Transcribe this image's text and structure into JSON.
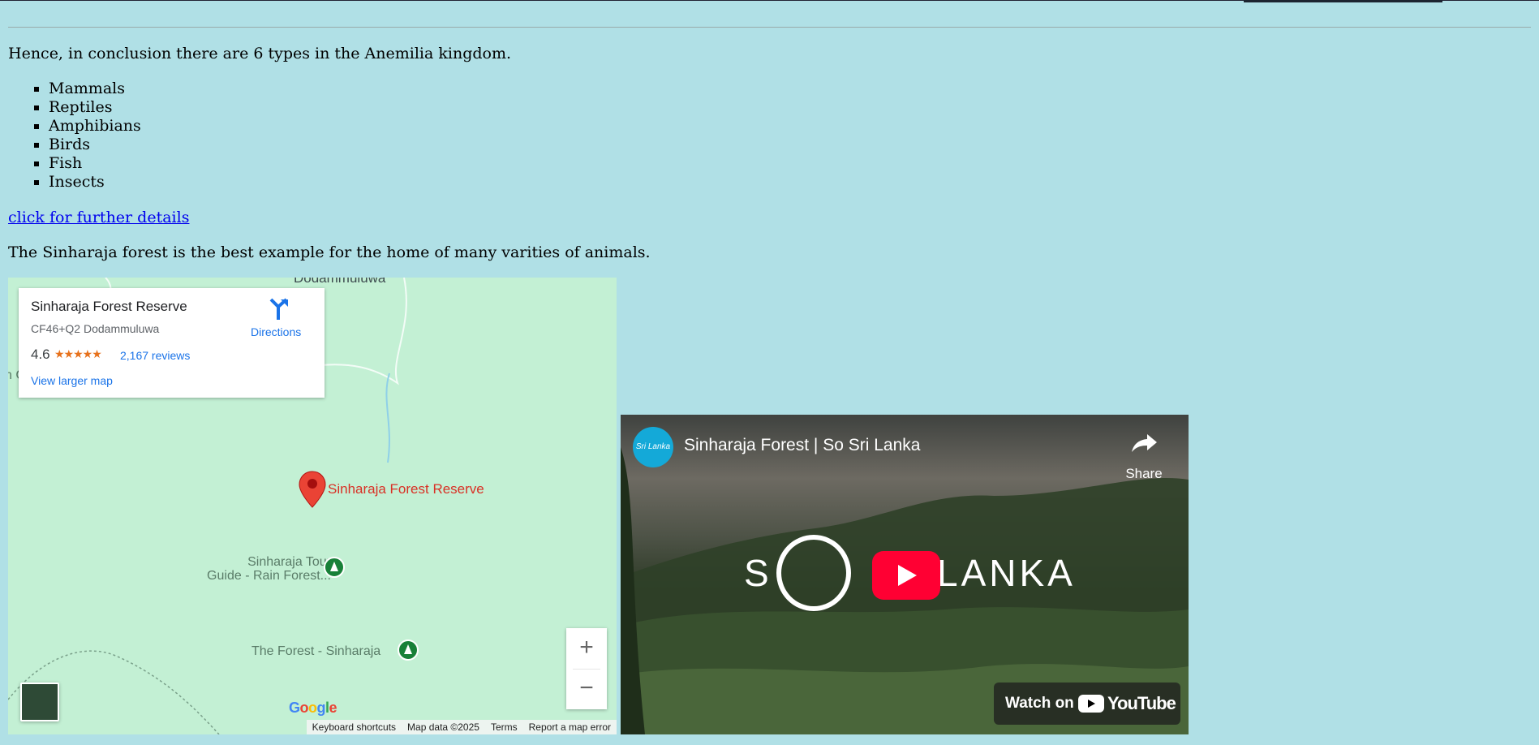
{
  "article": {
    "intro": "Hence, in conclusion there are 6 types in the Anemilia kingdom.",
    "types": [
      "Mammals",
      "Reptiles",
      "Amphibians",
      "Birds",
      "Fish",
      "Insects"
    ],
    "link_label": "click for further details",
    "forest_text": "The Sinharaja forest is the best example for the home of many varities of animals."
  },
  "map": {
    "top_label": "Dodammuluwa",
    "left_label": "n G",
    "card": {
      "title": "Sinharaja Forest Reserve",
      "address": "CF46+Q2 Dodammuluwa",
      "rating": "4.6",
      "stars": "★★★★★",
      "reviews": "2,167 reviews",
      "larger_map": "View larger map",
      "directions": "Directions"
    },
    "pin_label": "Sinharaja Forest Reserve",
    "places": [
      "Sinharaja Tour\nGuide - Rain Forest...",
      "The Forest - Sinharaja"
    ],
    "zoom_in": "+",
    "zoom_out": "−",
    "logo": "Google",
    "attribution": [
      "Keyboard shortcuts",
      "Map data ©2025",
      "Terms",
      "Report a map error"
    ]
  },
  "video": {
    "title": "Sinharaja Forest | So Sri Lanka",
    "channel_avatar": "Sri Lanka",
    "share": "Share",
    "brand_left": "S",
    "brand_right": "LANKA",
    "watch_on": "Watch on",
    "youtube": "YouTube"
  },
  "colors": {
    "page_bg": "#b0e0e6",
    "map_bg": "#c3f0d4",
    "link": "#0000ee",
    "pin": "#d93025",
    "play": "#ff0033"
  }
}
